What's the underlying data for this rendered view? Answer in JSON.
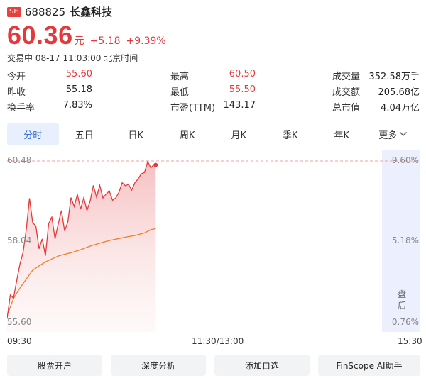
{
  "stock": {
    "exchange": "SH",
    "code": "688825",
    "name": "长鑫科技",
    "price": "60.36",
    "unit": "元",
    "change": "+5.18",
    "change_pct": "+9.39%",
    "status": "交易中 08-17 11:03:00 北京时间"
  },
  "stats": {
    "open_label": "今开",
    "open": "55.60",
    "prev_label": "昨收",
    "prev": "55.18",
    "turnover_label": "换手率",
    "turnover": "7.83%",
    "high_label": "最高",
    "high": "60.50",
    "low_label": "最低",
    "low": "55.50",
    "pe_label": "市盈(TTM)",
    "pe": "143.17",
    "vol_label": "成交量",
    "vol": "352.58万手",
    "amount_label": "成交额",
    "amount": "205.68亿",
    "mcap_label": "总市值",
    "mcap": "4.04万亿"
  },
  "tabs": [
    "分时",
    "五日",
    "日K",
    "周K",
    "月K",
    "季K",
    "年K",
    "更多"
  ],
  "chart_data": {
    "type": "line",
    "y_labels": [
      "60.48",
      "58.04",
      "55.60"
    ],
    "right_labels": [
      "9.60%",
      "5.18%",
      "0.76%"
    ],
    "after_hours": [
      "盘",
      "后"
    ],
    "x_labels": [
      "09:30",
      "11:30/13:00",
      "15:30"
    ],
    "ylim": [
      55.6,
      60.48
    ],
    "time_axis": "09:30–11:30, 13:00–15:30 (240 min session)",
    "series": [
      {
        "color": "#e4393c",
        "x": [
          0,
          2,
          4,
          6,
          8,
          10,
          12,
          14,
          16,
          18,
          20,
          22,
          24,
          26,
          28,
          30,
          32,
          34,
          36,
          38,
          40,
          42,
          44,
          46,
          48,
          50,
          52,
          54,
          56,
          58,
          60,
          62,
          64,
          66,
          68,
          70,
          72,
          74,
          76,
          78,
          80,
          82,
          84,
          86,
          88,
          90,
          92,
          93
        ],
        "values": [
          55.7,
          56.42,
          56.32,
          56.85,
          57.35,
          57.71,
          58.4,
          59.35,
          58.61,
          58.51,
          57.82,
          58.12,
          57.61,
          58.58,
          58.78,
          58.12,
          58.57,
          58.98,
          58.36,
          58.63,
          59.37,
          59.1,
          59.47,
          59.02,
          59.37,
          58.98,
          59.27,
          59.74,
          59.38,
          59.74,
          59.36,
          59.48,
          59.57,
          59.29,
          59.36,
          59.53,
          59.82,
          59.73,
          59.77,
          59.6,
          59.82,
          59.94,
          60.09,
          60.13,
          60.46,
          60.27,
          60.38,
          60.36
        ]
      },
      {
        "color": "#f07f2a",
        "x": [
          0,
          4,
          8,
          12,
          16,
          20,
          24,
          28,
          32,
          36,
          40,
          46,
          52,
          58,
          64,
          70,
          76,
          80,
          86,
          90,
          93
        ],
        "values": [
          55.8,
          56.31,
          56.63,
          56.9,
          57.17,
          57.3,
          57.42,
          57.51,
          57.6,
          57.65,
          57.7,
          57.79,
          57.9,
          57.99,
          58.07,
          58.13,
          58.19,
          58.22,
          58.3,
          58.4,
          58.43
        ]
      }
    ]
  },
  "colors": {
    "up": "#e4393c",
    "avg_line": "#f07f2a",
    "tab_active": "#3a6fd8",
    "after_hours_band": "#eceffe"
  },
  "actions": [
    "股票开户",
    "深度分析",
    "添加自选",
    "FinScope AI助手"
  ]
}
